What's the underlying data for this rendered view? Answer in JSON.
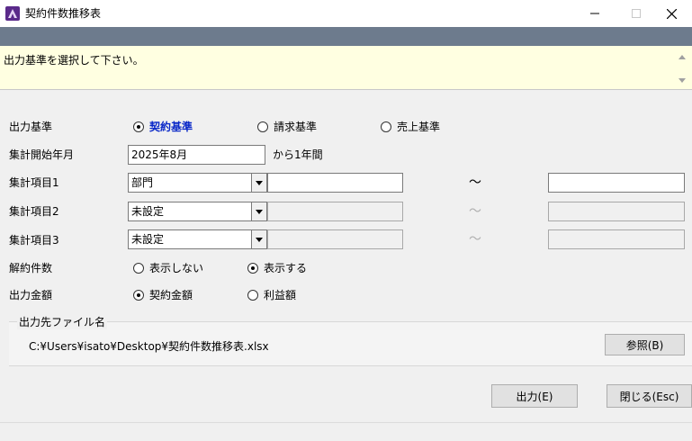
{
  "window": {
    "title": "契約件数推移表",
    "icon": "app-logo-icon",
    "controls": {
      "minimize_icon": "minimize-icon",
      "maximize_icon": "maximize-icon",
      "close_icon": "close-icon"
    }
  },
  "message": {
    "text": "出力基準を選択して下さい。"
  },
  "output_basis": {
    "label": "出力基準",
    "options": [
      {
        "label": "契約基準",
        "selected": true
      },
      {
        "label": "請求基準",
        "selected": false
      },
      {
        "label": "売上基準",
        "selected": false
      }
    ]
  },
  "start_month": {
    "label": "集計開始年月",
    "value": "2025年8月",
    "suffix": "から1年間"
  },
  "item1": {
    "label": "集計項目1",
    "value": "部門",
    "range_sep": "～",
    "from": "",
    "to": ""
  },
  "item2": {
    "label": "集計項目2",
    "value": "未設定",
    "range_sep": "～",
    "from": "",
    "to": ""
  },
  "item3": {
    "label": "集計項目3",
    "value": "未設定",
    "range_sep": "～",
    "from": "",
    "to": ""
  },
  "cancel_count": {
    "label": "解約件数",
    "options": [
      {
        "label": "表示しない",
        "selected": false
      },
      {
        "label": "表示する",
        "selected": true
      }
    ]
  },
  "output_amount": {
    "label": "出力金額",
    "options": [
      {
        "label": "契約金額",
        "selected": true
      },
      {
        "label": "利益額",
        "selected": false
      }
    ]
  },
  "output_file": {
    "group_label": "出力先ファイル名",
    "path": "C:¥Users¥isato¥Desktop¥契約件数推移表.xlsx",
    "browse_label": "参照(B)"
  },
  "actions": {
    "output_label": "出力(E)",
    "close_label": "閉じる(Esc)"
  },
  "colors": {
    "selected_radio_text": "#0a28c8",
    "message_bg": "#ffffe1",
    "strip": "#6d7b8d"
  }
}
